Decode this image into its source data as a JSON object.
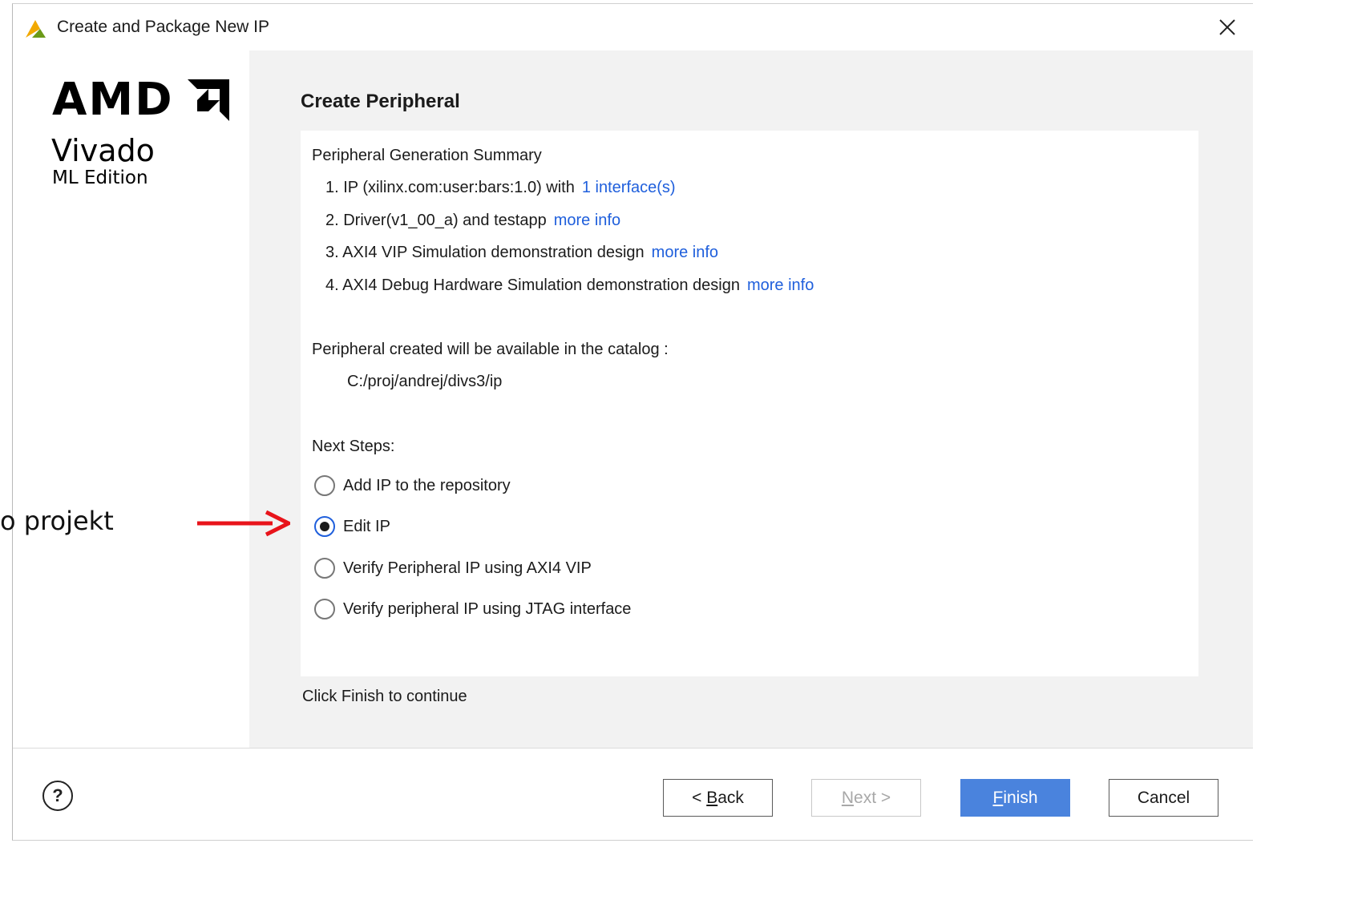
{
  "window": {
    "title": "Create and Package New IP"
  },
  "sidebar": {
    "brand": "AMD",
    "product": "Vivado",
    "edition": "ML Edition"
  },
  "page": {
    "title": "Create Peripheral",
    "summary_heading": "Peripheral Generation Summary",
    "summary_items": [
      {
        "text": "1. IP (xilinx.com:user:bars:1.0) with",
        "link": "1 interface(s)"
      },
      {
        "text": "2. Driver(v1_00_a) and testapp",
        "link": "more info"
      },
      {
        "text": "3. AXI4 VIP Simulation demonstration design",
        "link": "more info"
      },
      {
        "text": "4. AXI4 Debug Hardware Simulation demonstration design",
        "link": "more info"
      }
    ],
    "catalog_heading": "Peripheral created will be available in the catalog :",
    "catalog_path": "C:/proj/andrej/divs3/ip",
    "next_steps_heading": "Next Steps:",
    "next_steps": [
      {
        "label": "Add IP to the repository",
        "selected": false
      },
      {
        "label": "Edit IP",
        "selected": true
      },
      {
        "label": "Verify Peripheral IP using AXI4 VIP",
        "selected": false
      },
      {
        "label": "Verify peripheral IP using JTAG interface",
        "selected": false
      }
    ],
    "footer_note": "Click Finish to continue"
  },
  "buttons": {
    "help": "?",
    "back": {
      "prefix": "< ",
      "mnemonic": "B",
      "rest": "ack"
    },
    "next": {
      "mnemonic": "N",
      "rest": "ext >",
      "disabled": true
    },
    "finish": {
      "mnemonic": "F",
      "rest": "inish"
    },
    "cancel": "Cancel"
  },
  "annotation": {
    "text": "o projekt",
    "arrow_color": "#e8141b"
  },
  "colors": {
    "link": "#1f5fdc",
    "primary_button": "#4a83dd",
    "content_bg": "#f2f2f2"
  }
}
